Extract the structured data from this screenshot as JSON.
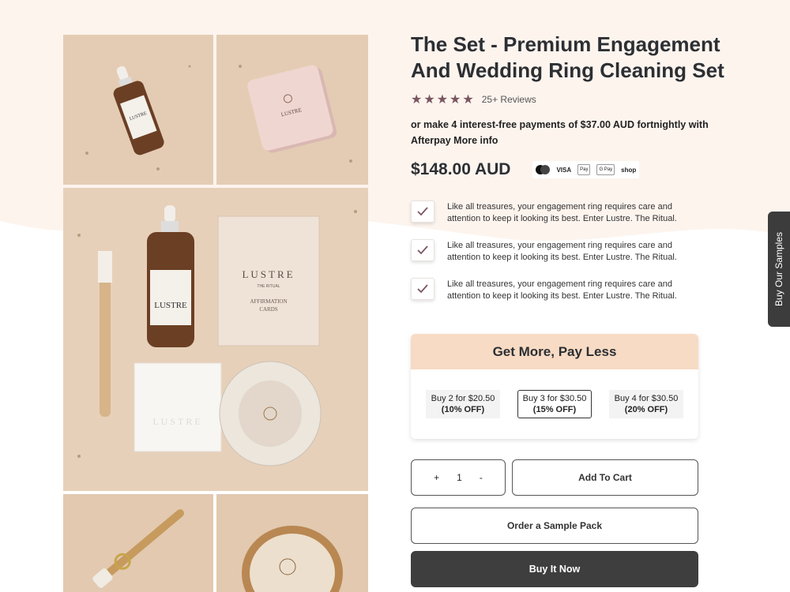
{
  "product": {
    "title": "The Set - Premium Engagement And Wedding Ring Cleaning Set",
    "stars": "★★★★★",
    "rating_value": 5,
    "reviews": "25+ Reviews",
    "afterpay_text": "or make 4 interest-free payments of  $37.00 AUD fortnightly with Afterpay More info",
    "price": "$148.00 AUD"
  },
  "payment_methods": [
    {
      "name": "mastercard-icon",
      "label": ""
    },
    {
      "name": "visa-icon",
      "label": "VISA"
    },
    {
      "name": "apple-pay-icon",
      "label": "Pay"
    },
    {
      "name": "google-pay-icon",
      "label": "G Pay"
    },
    {
      "name": "shop-pay-icon",
      "label": "shop"
    }
  ],
  "features": [
    "Like all treasures, your engagement ring requires care and attention to keep it looking its best. Enter Lustre. The Ritual.",
    "Like all treasures, your engagement ring requires care and attention to keep it looking its best. Enter Lustre. The Ritual.",
    "Like all treasures, your engagement ring requires care and attention to keep it looking its best. Enter Lustre. The Ritual."
  ],
  "bundle": {
    "heading": "Get More, Pay Less",
    "offers": [
      {
        "line1": "Buy 2 for $20.50",
        "line2": "(10% OFF)",
        "selected": false
      },
      {
        "line1": "Buy 3 for $30.50",
        "line2": "(15% OFF)",
        "selected": true
      },
      {
        "line1": "Buy 4 for $30.50",
        "line2": "(20% OFF)",
        "selected": false
      }
    ]
  },
  "cart": {
    "plus": "+",
    "quantity": "1",
    "minus": "-",
    "add_to_cart": "Add To Cart",
    "sample_pack": "Order a Sample Pack",
    "buy_now": "Buy It Now"
  },
  "side_tab": "Buy Our Samples",
  "images": {
    "brand": "LUSTRE",
    "subtitle": "THE RITUAL",
    "cards_label_1": "AFFIRMATION",
    "cards_label_2": "CARDS"
  },
  "colors": {
    "accent_dark": "#3e3e3e",
    "bundle_header": "#f7dbc4",
    "star": "#7a5560",
    "page_tint": "#fdf4ee",
    "stone": "#e5cdb5"
  }
}
